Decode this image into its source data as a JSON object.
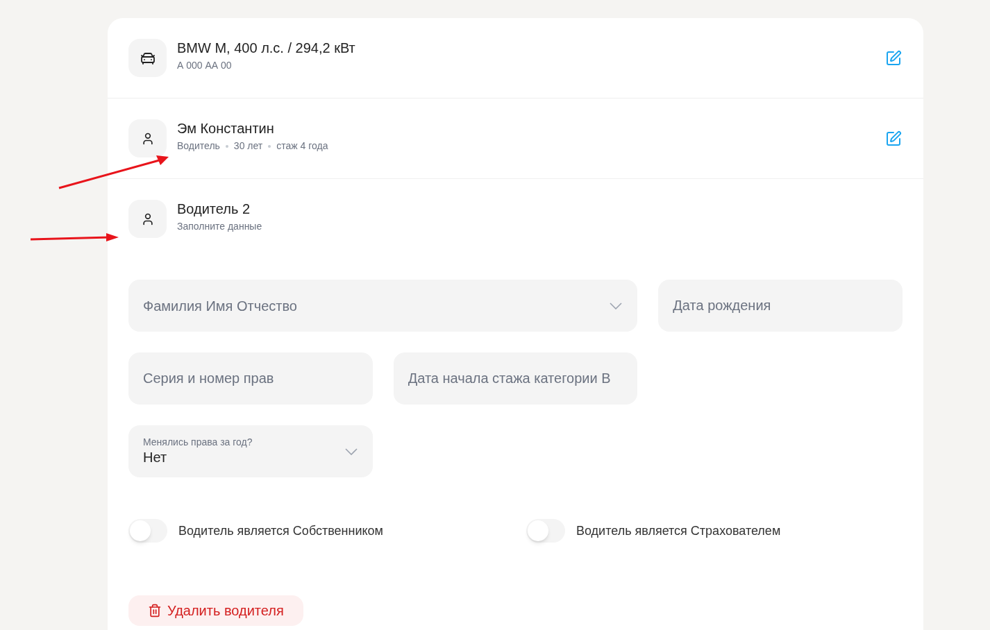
{
  "vehicle": {
    "title": "BMW M, 400 л.с. / 294,2 кВт",
    "subtitle": "А 000 АА 00"
  },
  "driver": {
    "name": "Эм Константин",
    "details": [
      "Водитель",
      "30 лет",
      "стаж 4 года"
    ]
  },
  "new_driver": {
    "title": "Водитель 2",
    "subtitle": "Заполните данные"
  },
  "fields": [
    {
      "kind": "select",
      "placeholder": "Фамилия Имя Отчество"
    },
    {
      "kind": "text",
      "placeholder": "Дата рождения"
    },
    {
      "kind": "text",
      "placeholder": "Серия и номер прав"
    },
    {
      "kind": "text",
      "placeholder": "Дата начала стажа категории B"
    },
    {
      "kind": "labeled_select",
      "label": "Менялись права за год?",
      "value": "Нет"
    }
  ],
  "toggles": [
    {
      "label": "Водитель является Собственником",
      "on": false
    },
    {
      "label": "Водитель является Страхователем",
      "on": false
    }
  ],
  "delete_button": "Удалить водителя"
}
